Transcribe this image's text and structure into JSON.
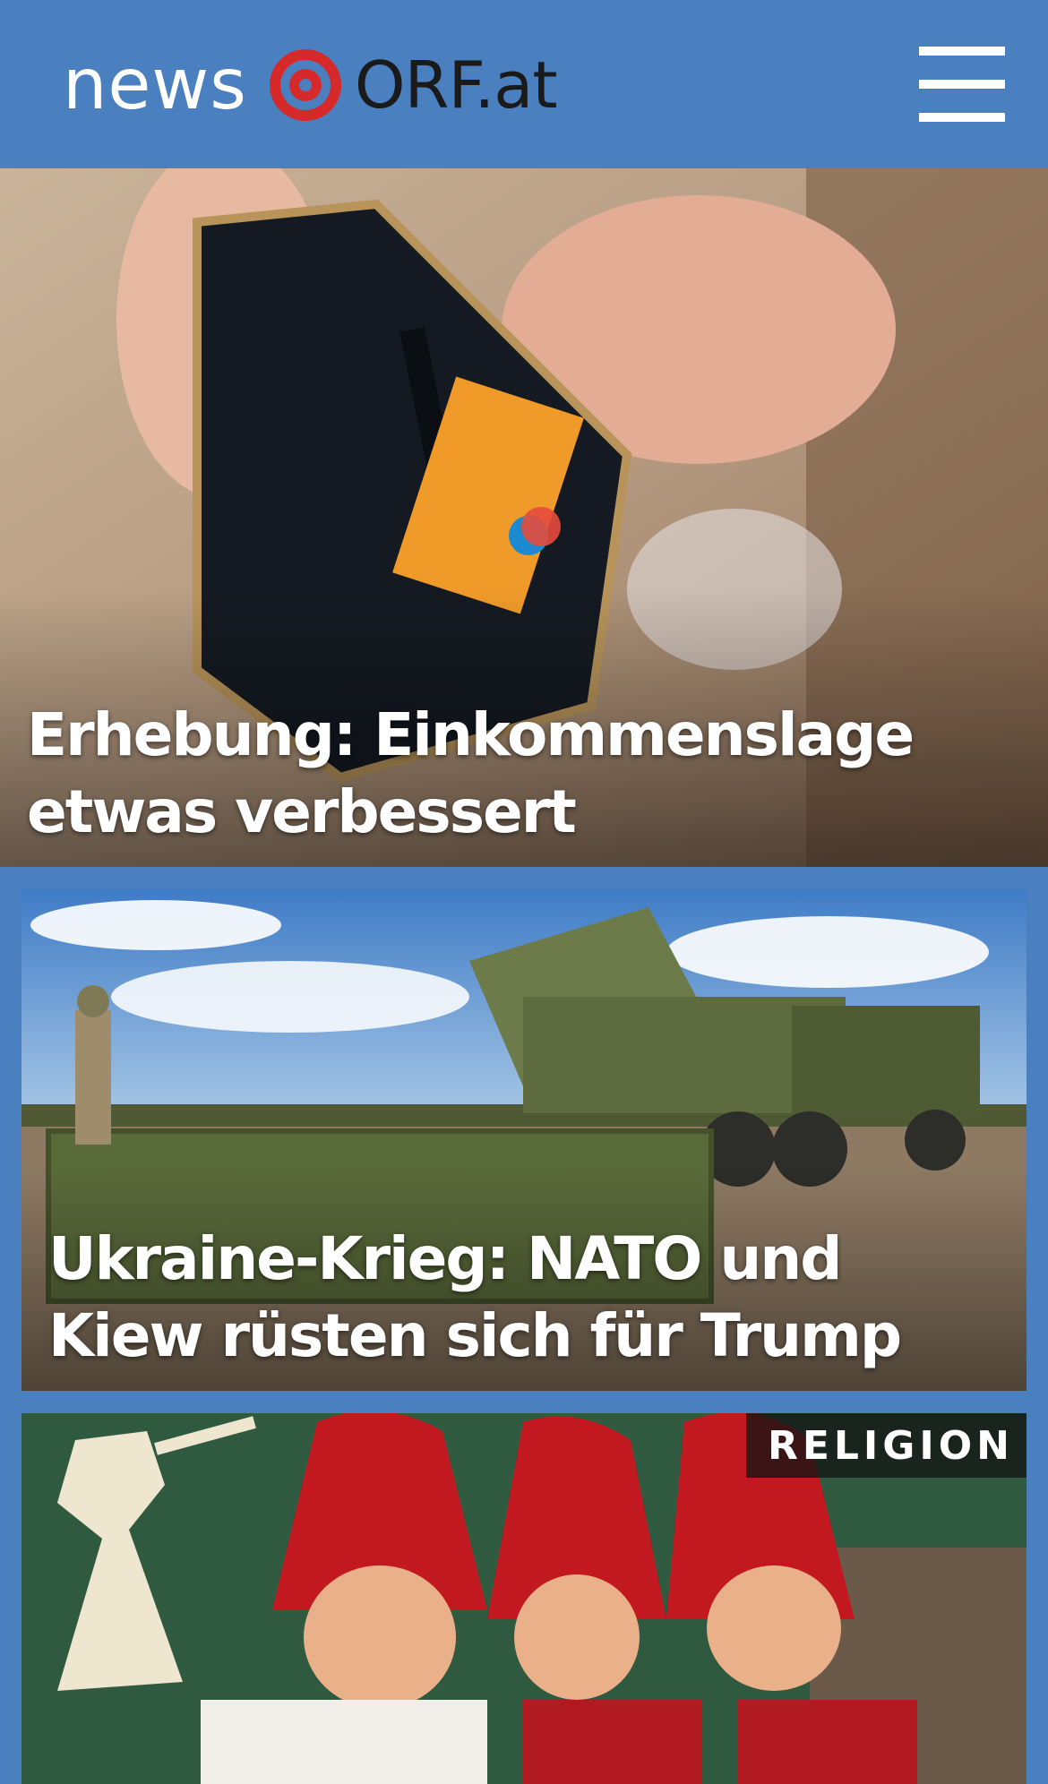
{
  "header": {
    "logo_news": "news",
    "logo_orf": "ORF.at",
    "menu_icon": "hamburger-menu-icon",
    "background_color": "#4a7fc0",
    "brand_red": "#d62a2a"
  },
  "stories": [
    {
      "headline": "Erhebung: Einkommenslage etwas verbessert",
      "image": "hand-pulling-card-from-wallet"
    },
    {
      "headline": "Ukraine-Krieg: NATO und Kiew rüsten sich für Trump",
      "image": "military-rocket-launcher-truck"
    },
    {
      "category": "RELIGION",
      "image": "christmas-gnome-dolls-with-angel"
    }
  ]
}
